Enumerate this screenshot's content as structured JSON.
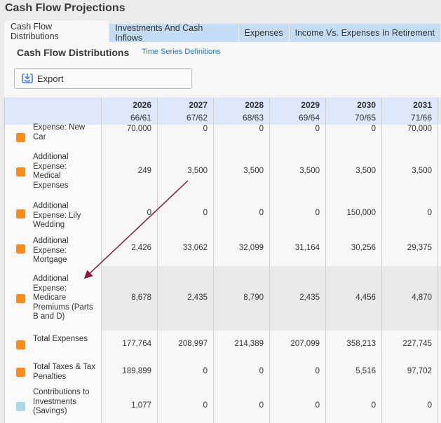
{
  "page_title": "Cash Flow Projections",
  "tabs": [
    {
      "label": "Cash Flow Distributions",
      "active": true
    },
    {
      "label": "Investments And Cash Inflows"
    },
    {
      "label": "Expenses"
    },
    {
      "label": "Income Vs. Expenses In Retirement"
    }
  ],
  "section_title": "Cash Flow Distributions",
  "time_series_link": "Time Series Definitions",
  "export_label": "Export",
  "colors": {
    "orange": "#ff8c1a",
    "light_blue": "#a8d8e8",
    "header_bg": "#dde9fb",
    "arrow": "#8b1a3a"
  },
  "columns": [
    {
      "year": "2026",
      "ages": "66/61"
    },
    {
      "year": "2027",
      "ages": "67/62"
    },
    {
      "year": "2028",
      "ages": "68/63"
    },
    {
      "year": "2029",
      "ages": "69/64"
    },
    {
      "year": "2030",
      "ages": "70/65"
    },
    {
      "year": "2031",
      "ages": "71/66"
    }
  ],
  "rows": [
    {
      "label": "Expense: New Car",
      "color": "#ff8c1a",
      "values": [
        "70,000",
        "0",
        "0",
        "0",
        "0",
        "70,000"
      ]
    },
    {
      "label": "Additional Expense: Medical Expenses",
      "color": "#ff8c1a",
      "values": [
        "249",
        "3,500",
        "3,500",
        "3,500",
        "3,500",
        "3,500"
      ]
    },
    {
      "label": "Additional Expense: Lily Wedding",
      "color": "#ff8c1a",
      "values": [
        "0",
        "0",
        "0",
        "0",
        "150,000",
        "0"
      ]
    },
    {
      "label": "Additional Expense: Mortgage",
      "color": "#ff8c1a",
      "values": [
        "2,426",
        "33,062",
        "32,099",
        "31,164",
        "30,256",
        "29,375"
      ]
    },
    {
      "label": "Additional Expense: Medicare Premiums (Parts B and D)",
      "color": "#ff8c1a",
      "values": [
        "8,678",
        "2,435",
        "8,790",
        "2,435",
        "4,456",
        "4,870"
      ],
      "highlighted": true
    },
    {
      "label": "Total Expenses",
      "color": "#ff8c1a",
      "values": [
        "177,764",
        "208,997",
        "214,389",
        "207,099",
        "358,213",
        "227,745"
      ]
    },
    {
      "label": "Total Taxes & Tax Penalties",
      "color": "#ff8c1a",
      "values": [
        "189,899",
        "0",
        "0",
        "0",
        "5,516",
        "97,702"
      ]
    },
    {
      "label": "Contributions to Investments (Savings)",
      "color": "#a8d8e8",
      "values": [
        "1,077",
        "0",
        "0",
        "0",
        "0",
        "0"
      ]
    }
  ]
}
